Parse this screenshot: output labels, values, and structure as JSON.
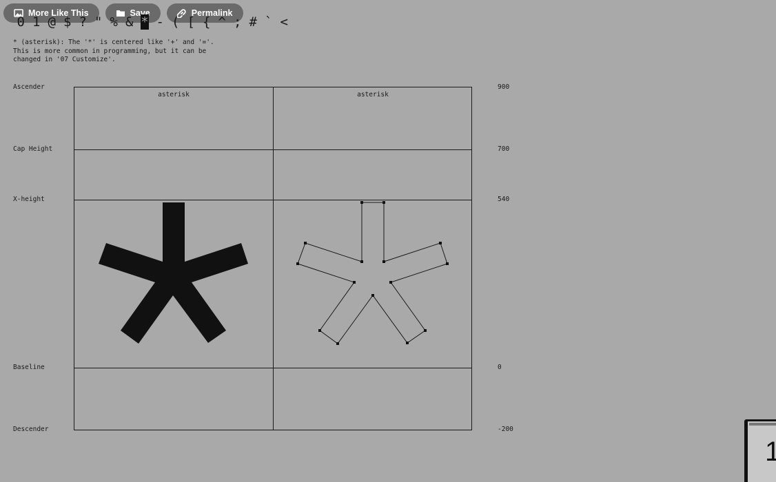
{
  "header_actions": [
    {
      "label": "More Like This",
      "icon": "image-icon"
    },
    {
      "label": "Save",
      "icon": "folder-icon"
    },
    {
      "label": "Permalink",
      "icon": "link-icon"
    }
  ],
  "glyph_strip": [
    "0",
    "1",
    "@",
    "$",
    "?",
    "\"",
    "%",
    "&",
    "*",
    "-",
    "(",
    "[",
    "{",
    "^",
    ";",
    "#",
    "`",
    "<"
  ],
  "selected_glyph_index": 8,
  "description": {
    "line1": "* (asterisk): The '*' is centered like '+' and '='.",
    "line2": "This is more common in programming, but it can be",
    "line3": "changed in '07 Customize'."
  },
  "metrics": [
    {
      "label": "Ascender",
      "value": "900"
    },
    {
      "label": "Cap Height",
      "value": "700"
    },
    {
      "label": "X-height",
      "value": "540"
    },
    {
      "label": "Baseline",
      "value": "0"
    },
    {
      "label": "Descender",
      "value": "-200"
    }
  ],
  "panels": {
    "left_title": "asterisk",
    "right_title": "asterisk"
  },
  "colors": {
    "background": "#a9a9a9",
    "ink": "#1a1a1a",
    "pill": "#6a6a6a"
  }
}
